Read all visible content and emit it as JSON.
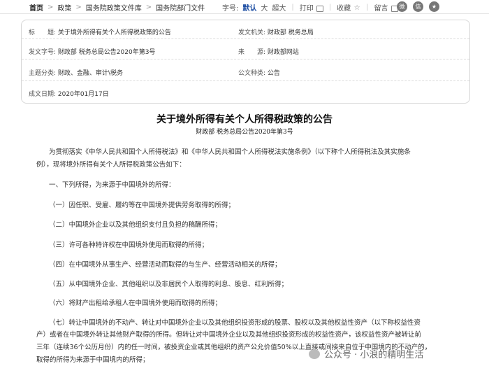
{
  "breadcrumb": {
    "home": "首页",
    "items": [
      "政策",
      "国务院政策文件库",
      "国务院部门文件"
    ]
  },
  "toolbar": {
    "font_label": "字号:",
    "font_default": "默认",
    "font_large": "大",
    "font_xlarge": "超大",
    "print": "打印",
    "favorite": "收藏",
    "comment": "留言"
  },
  "meta": {
    "title_k": "标　　题:",
    "title_v": "关于境外所得有关个人所得税政策的公告",
    "issuer_k": "发文机关:",
    "issuer_v": "财政部  税务总局",
    "docno_k": "发文字号:",
    "docno_v": "财政部  税务总局公告2020年第3号",
    "source_k": "来　　源:",
    "source_v": "财政部网站",
    "topic_k": "主题分类:",
    "topic_v": "财政、金融、审计\\税务",
    "type_k": "公文种类:",
    "type_v": "公告",
    "date_k": "成文日期:",
    "date_v": "2020年01月17日"
  },
  "article": {
    "title": "关于境外所得有关个人所得税政策的公告",
    "subtitle": "财政部  税务总局公告2020年第3号",
    "p0a": "为贯彻落实《中华人民共和国个人所得税法》和《中华人民共和国个人所得税法实施条例》（以下称个人所得税法及其实施条",
    "p0b": "例），现将境外所得有关个人所得税政策公告如下：",
    "p1": "一、下列所得，为来源于中国境外的所得：",
    "p2": "（一）因任职、受雇、履约等在中国境外提供劳务取得的所得；",
    "p3": "（二）中国境外企业以及其他组织支付且负担的稿酬所得；",
    "p4": "（三）许可各种特许权在中国境外使用而取得的所得；",
    "p5": "（四）在中国境外从事生产、经营活动而取得的与生产、经营活动相关的所得；",
    "p6": "（五）从中国境外企业、其他组织以及非居民个人取得的利息、股息、红利所得；",
    "p7": "（六）将财产出租给承租人在中国境外使用而取得的所得；",
    "p8a": "（七）转让中国境外的不动产、转让对中国境外企业以及其他组织投资形成的股票、股权以及其他权益性资产（以下称权益性资",
    "p8b": "产）或者在中国境外转让其他财产取得的所得。但转让对中国境外企业以及其他组织投资形成的权益性资产，该权益性资产被转让前",
    "p8c": "三年（连续36个公历月份）内的任一时间，被投资企业或其他组织的资产公允价值50%以上直接或间接来自位于中国境内的不动产的，",
    "p8d": "取得的所得为来源于中国境内的所得；"
  },
  "watermark": "公众号 · 小浪的精明生活"
}
